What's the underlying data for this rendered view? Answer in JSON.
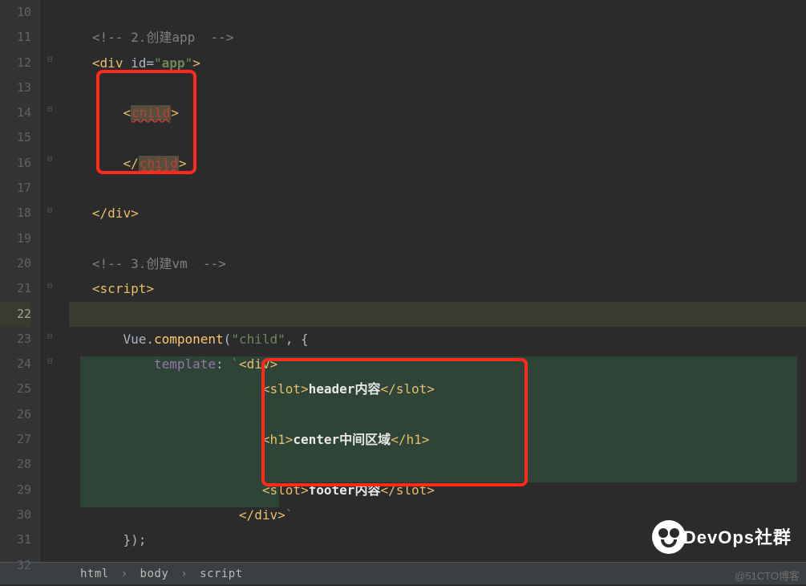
{
  "gutter": {
    "start": 10,
    "end": 32,
    "active": 22
  },
  "lines": {
    "10": "",
    "comment1": "<!-- 2.创建app  -->",
    "div_open": {
      "t1": "<",
      "tag": "div",
      "sp": " ",
      "attr": "id",
      "eq": "=",
      "q": "\"",
      "val": "app",
      "q2": "\"",
      "t2": ">"
    },
    "child_open": {
      "t1": "<",
      "tag": "child",
      "t2": ">"
    },
    "child_close": {
      "t1": "</",
      "tag": "child",
      "t2": ">"
    },
    "div_close": {
      "t1": "</",
      "tag": "div",
      "t2": ">"
    },
    "comment2": "<!-- 3.创建vm  -->",
    "script_open": {
      "t1": "<",
      "tag": "script",
      "t2": ">"
    },
    "vue_line": {
      "p1": "Vue.",
      "fn": "component",
      "p2": "(",
      "s": "\"child\"",
      "p3": ", {"
    },
    "template_line": {
      "prop": "template",
      "col": ": ",
      "tick": "`",
      "t1": "<",
      "tag": "div",
      "t2": ">"
    },
    "slot1": {
      "t1": "<",
      "tag": "slot",
      "t2": ">",
      "txt": "header内容",
      "t3": "</",
      "tag2": "slot",
      "t4": ">"
    },
    "h1": {
      "t1": "<",
      "tag": "h1",
      "t2": ">",
      "txt": "center中间区域",
      "t3": "</",
      "tag2": "h1",
      "t4": ">"
    },
    "slot2": {
      "t1": "<",
      "tag": "slot",
      "t2": ">",
      "txt": "footer内容",
      "t3": "</",
      "tag2": "slot",
      "t4": ">"
    },
    "div_close2": {
      "t1": "</",
      "tag": "div",
      "t2": ">",
      "tick": "`"
    },
    "close_comp": "});"
  },
  "breadcrumb": [
    "html",
    "body",
    "script"
  ],
  "watermark": {
    "brand": "DevOps社群",
    "sub": "@51CTO博客"
  }
}
